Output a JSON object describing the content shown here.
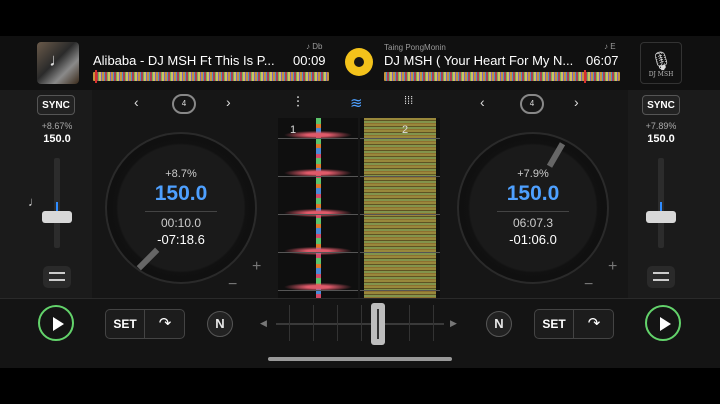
{
  "deck1": {
    "title": "Alibaba - DJ MSH Ft This Is P...",
    "key": "♪ Db",
    "time": "00:09",
    "pitch": "+8.67%",
    "bpm": "150.0",
    "sync": "SYNC",
    "loop": "4",
    "jog_pct": "+8.7%",
    "jog_bpm": "150.0",
    "elapsed": "00:10.0",
    "remaining": "-07:18.6",
    "deck_num": "1",
    "set": "SET",
    "neural": "N"
  },
  "deck2": {
    "artist": "Taing PongMonin",
    "title": "DJ MSH ( Your Heart For My N...",
    "key": "♪ E",
    "time": "06:07",
    "cover_text": "DJ MSH",
    "pitch": "+7.89%",
    "bpm": "150.0",
    "sync": "SYNC",
    "loop": "4",
    "jog_pct": "+7.9%",
    "jog_bpm": "150.0",
    "elapsed": "06:07.3",
    "remaining": "-01:06.0",
    "deck_num": "2",
    "set": "SET",
    "neural": "N"
  },
  "icons": {
    "prev": "‹",
    "next": "›",
    "plus": "+",
    "minus": "−",
    "note": "♩",
    "tri_left": "◀",
    "tri_right": "▶",
    "cue_arrow": "↷",
    "mixer": "⫶",
    "waveform": "≋",
    "grid": "⁞⁞⁞"
  },
  "colors": {
    "accent_blue": "#4ea0ff",
    "play_green": "#63d36b",
    "logo_yellow": "#f3c21b"
  }
}
